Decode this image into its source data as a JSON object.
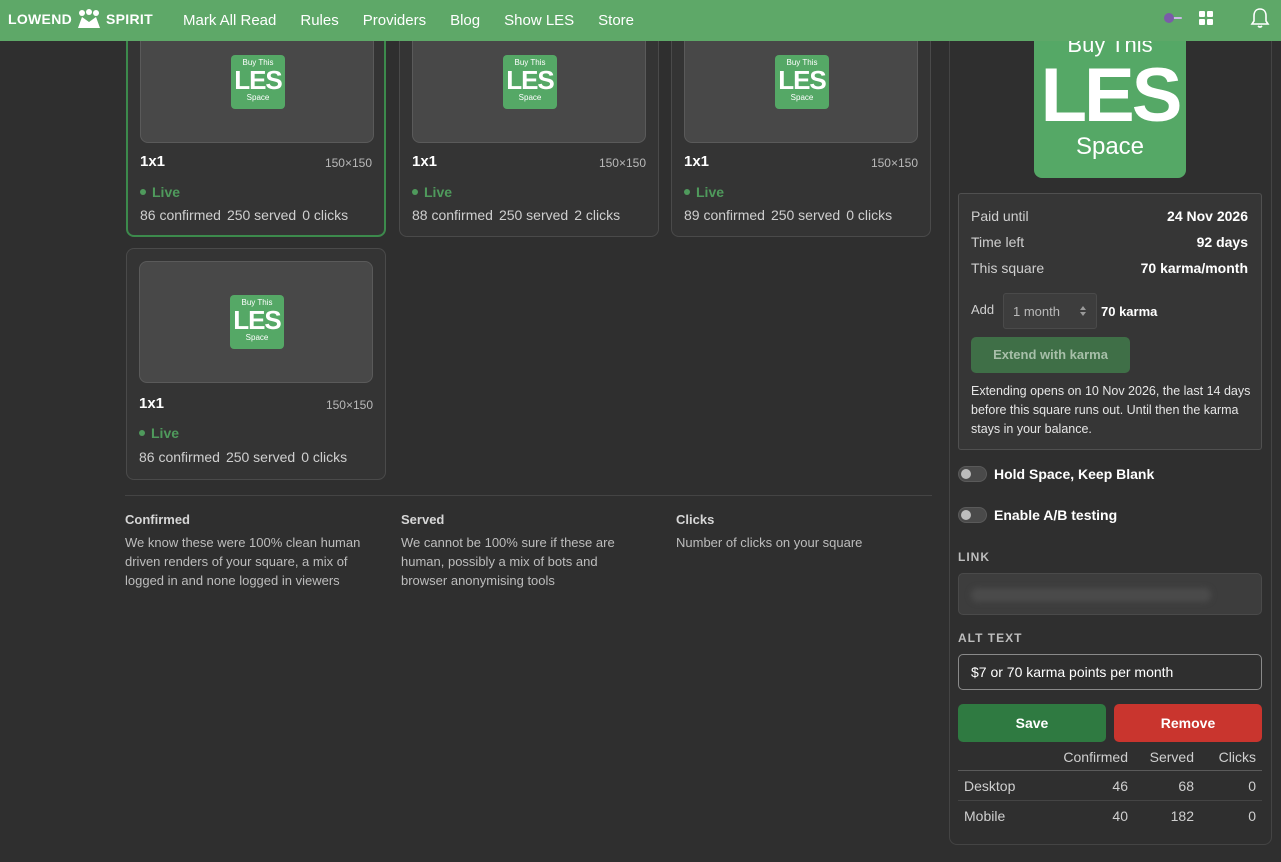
{
  "brand": {
    "name_left": "LOWEND",
    "name_right": "SPIRIT"
  },
  "nav": [
    "Mark All Read",
    "Rules",
    "Providers",
    "Blog",
    "Show LES",
    "Store"
  ],
  "badge": {
    "top": "Buy This",
    "middle": "LES",
    "bottom": "Space"
  },
  "squares": [
    {
      "title": "1x1",
      "dims": "150×150",
      "status": "Live",
      "confirmed": "86 confirmed",
      "served": "250 served",
      "clicks": "0 clicks",
      "selected": true
    },
    {
      "title": "1x1",
      "dims": "150×150",
      "status": "Live",
      "confirmed": "88 confirmed",
      "served": "250 served",
      "clicks": "2 clicks",
      "selected": false
    },
    {
      "title": "1x1",
      "dims": "150×150",
      "status": "Live",
      "confirmed": "89 confirmed",
      "served": "250 served",
      "clicks": "0 clicks",
      "selected": false
    },
    {
      "title": "1x1",
      "dims": "150×150",
      "status": "Live",
      "confirmed": "86 confirmed",
      "served": "250 served",
      "clicks": "0 clicks",
      "selected": false
    }
  ],
  "legend": [
    {
      "title": "Confirmed",
      "text": "We know these were 100% clean human driven renders of your square, a mix of logged in and none logged in viewers"
    },
    {
      "title": "Served",
      "text": "We cannot be 100% sure if these are human, possibly a mix of bots and browser anonymising tools"
    },
    {
      "title": "Clicks",
      "text": "Number of clicks on your square"
    }
  ],
  "panel": {
    "paid_until_label": "Paid until",
    "paid_until_value": "24 Nov 2026",
    "time_left_label": "Time left",
    "time_left_value": "92 days",
    "square_label": "This square",
    "square_value": "70 karma/month",
    "add_label": "Add",
    "add_select": "1 month",
    "add_karma": "70 karma",
    "extend_button": "Extend with karma",
    "extend_note": "Extending opens on 10 Nov 2026, the last 14 days before this square runs out. Until then the karma stays in your balance.",
    "hold_label": "Hold Space, Keep Blank",
    "ab_label": "Enable A/B testing",
    "link_label": "LINK",
    "alt_label": "ALT TEXT",
    "alt_value": "$7 or 70 karma points per month",
    "save_button": "Save",
    "remove_button": "Remove"
  },
  "stats": {
    "headers": [
      "",
      "Confirmed",
      "Served",
      "Clicks"
    ],
    "rows": [
      {
        "label": "Desktop",
        "confirmed": "46",
        "served": "68",
        "clicks": "0"
      },
      {
        "label": "Mobile",
        "confirmed": "40",
        "served": "182",
        "clicks": "0"
      }
    ]
  },
  "colors": {
    "accent": "#5ea868",
    "live": "#4f9a5c",
    "save": "#2f7a41",
    "remove": "#c9352e"
  }
}
